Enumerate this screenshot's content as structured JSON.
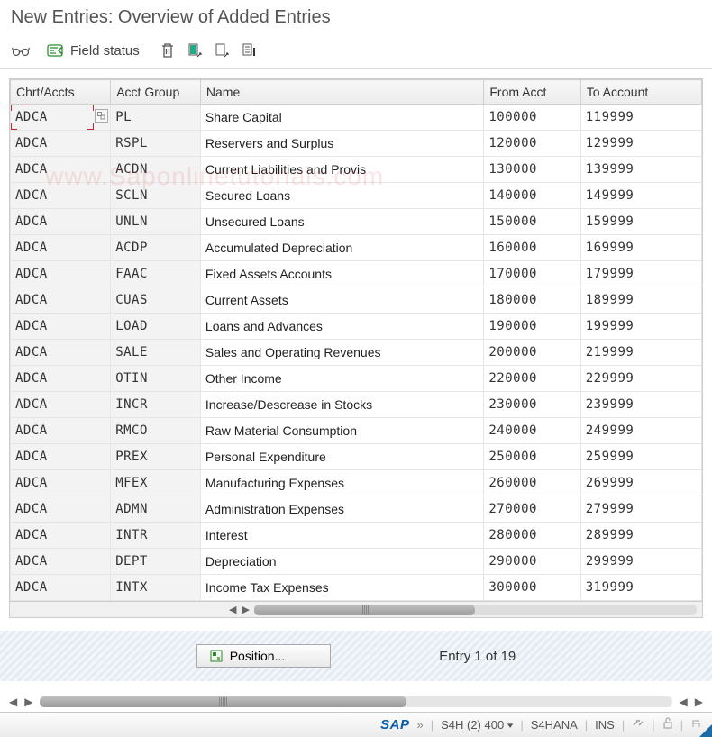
{
  "title": "New Entries: Overview of Added Entries",
  "toolbar": {
    "field_status_label": "Field status"
  },
  "columns": {
    "chrt": "Chrt/Accts",
    "group": "Acct Group",
    "name": "Name",
    "from": "From Acct",
    "to": "To Account"
  },
  "rows": [
    {
      "chrt": "ADCA",
      "grp": "PL",
      "name": "Share Capital",
      "from": "100000",
      "to": "119999"
    },
    {
      "chrt": "ADCA",
      "grp": "RSPL",
      "name": "Reservers and Surplus",
      "from": "120000",
      "to": "129999"
    },
    {
      "chrt": "ADCA",
      "grp": "ACDN",
      "name": "Current Liabilities and Provis",
      "from": "130000",
      "to": "139999"
    },
    {
      "chrt": "ADCA",
      "grp": "SCLN",
      "name": "Secured Loans",
      "from": "140000",
      "to": "149999"
    },
    {
      "chrt": "ADCA",
      "grp": "UNLN",
      "name": "Unsecured Loans",
      "from": "150000",
      "to": "159999"
    },
    {
      "chrt": "ADCA",
      "grp": "ACDP",
      "name": "Accumulated Depreciation",
      "from": "160000",
      "to": "169999"
    },
    {
      "chrt": "ADCA",
      "grp": "FAAC",
      "name": "Fixed Assets Accounts",
      "from": "170000",
      "to": "179999"
    },
    {
      "chrt": "ADCA",
      "grp": "CUAS",
      "name": "Current Assets",
      "from": "180000",
      "to": "189999"
    },
    {
      "chrt": "ADCA",
      "grp": "LOAD",
      "name": "Loans and Advances",
      "from": "190000",
      "to": "199999"
    },
    {
      "chrt": "ADCA",
      "grp": "SALE",
      "name": "Sales and Operating Revenues",
      "from": "200000",
      "to": "219999"
    },
    {
      "chrt": "ADCA",
      "grp": "OTIN",
      "name": "Other Income",
      "from": "220000",
      "to": "229999"
    },
    {
      "chrt": "ADCA",
      "grp": "INCR",
      "name": "Increase/Descrease in Stocks",
      "from": "230000",
      "to": "239999"
    },
    {
      "chrt": "ADCA",
      "grp": "RMCO",
      "name": "Raw Material Consumption",
      "from": "240000",
      "to": "249999"
    },
    {
      "chrt": "ADCA",
      "grp": "PREX",
      "name": "Personal Expenditure",
      "from": "250000",
      "to": "259999"
    },
    {
      "chrt": "ADCA",
      "grp": "MFEX",
      "name": "Manufacturing Expenses",
      "from": "260000",
      "to": "269999"
    },
    {
      "chrt": "ADCA",
      "grp": "ADMN",
      "name": "Administration Expenses",
      "from": "270000",
      "to": "279999"
    },
    {
      "chrt": "ADCA",
      "grp": "INTR",
      "name": "Interest",
      "from": "280000",
      "to": "289999"
    },
    {
      "chrt": "ADCA",
      "grp": "DEPT",
      "name": "Depreciation",
      "from": "290000",
      "to": "299999"
    },
    {
      "chrt": "ADCA",
      "grp": "INTX",
      "name": "Income Tax Expenses",
      "from": "300000",
      "to": "319999"
    }
  ],
  "position_label": "Position...",
  "entry_count": "Entry 1 of 19",
  "watermark": "www.Saponlinetutorials.com",
  "status": {
    "sap": "SAP",
    "system": "S4H (2) 400",
    "host": "S4HANA",
    "mode": "INS"
  }
}
